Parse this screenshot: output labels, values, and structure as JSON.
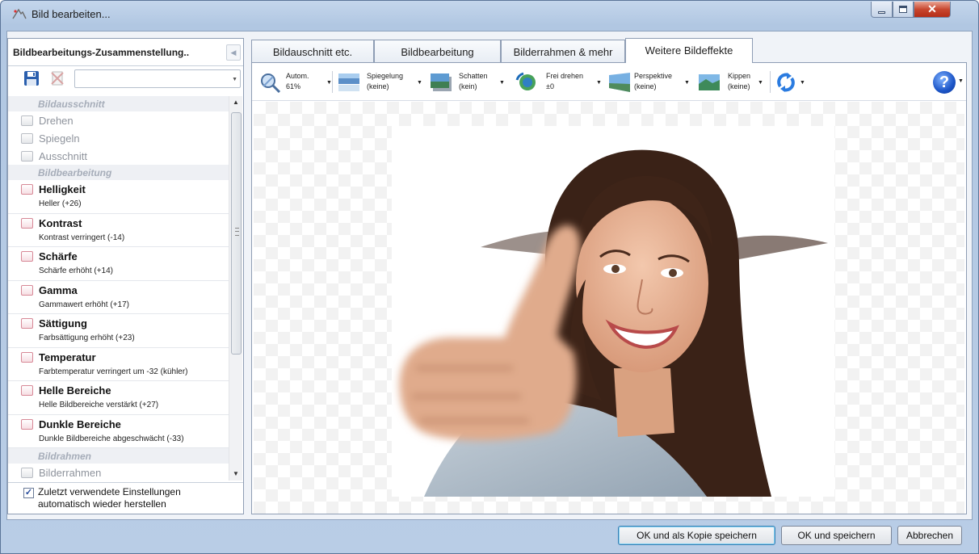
{
  "window": {
    "title": "Bild bearbeiten..."
  },
  "left_panel": {
    "title": "Bildbearbeitungs-Zusammenstellung..",
    "preset_value": "",
    "sections": [
      {
        "heading": "Bildausschnitt",
        "items": [
          "Drehen",
          "Spiegeln",
          "Ausschnitt"
        ]
      },
      {
        "heading": "Bildbearbeitung",
        "items": [
          {
            "label": "Helligkeit",
            "detail": "Heller (+26)"
          },
          {
            "label": "Kontrast",
            "detail": "Kontrast verringert (-14)"
          },
          {
            "label": "Schärfe",
            "detail": "Schärfe erhöht (+14)"
          },
          {
            "label": "Gamma",
            "detail": "Gammawert erhöht (+17)"
          },
          {
            "label": "Sättigung",
            "detail": "Farbsättigung erhöht (+23)"
          },
          {
            "label": "Temperatur",
            "detail": "Farbtemperatur verringert um -32 (kühler)"
          },
          {
            "label": "Helle Bereiche",
            "detail": "Helle Bildbereiche verstärkt (+27)"
          },
          {
            "label": "Dunkle Bereiche",
            "detail": "Dunkle Bildbereiche abgeschwächt (-33)"
          }
        ]
      },
      {
        "heading": "Bildrahmen",
        "items": [
          "Bilderrahmen"
        ]
      }
    ],
    "restore_checkbox": {
      "checked": true,
      "line1": "Zuletzt verwendete Einstellungen",
      "line2": "automatisch wieder herstellen"
    }
  },
  "tabs": [
    "Bildauschnitt etc.",
    "Bildbearbeitung",
    "Bilderrahmen & mehr",
    "Weitere Bildeffekte"
  ],
  "active_tab": "Weitere Bildeffekte",
  "toolbar": [
    {
      "line1": "Autom.",
      "line2": "61%",
      "icon": "zoom-icon"
    },
    {
      "line1": "Spiegelung",
      "line2": "(keine)",
      "icon": "reflection-icon"
    },
    {
      "line1": "Schatten",
      "line2": "(kein)",
      "icon": "shadow-icon"
    },
    {
      "line1": "Frei drehen",
      "line2": "±0",
      "icon": "rotate-free-icon"
    },
    {
      "line1": "Perspektive",
      "line2": "(keine)",
      "icon": "perspective-icon"
    },
    {
      "line1": "Kippen",
      "line2": "(keine)",
      "icon": "tilt-icon"
    }
  ],
  "help_glyph": "?",
  "buttons": {
    "ok_copy": "OK und als Kopie speichern",
    "ok_save": "OK und speichern",
    "cancel": "Abbrechen"
  },
  "colors": {
    "accent": "#3c7fb1",
    "window_frame": "#b9cde6",
    "checkbox_active": "#d78896"
  }
}
